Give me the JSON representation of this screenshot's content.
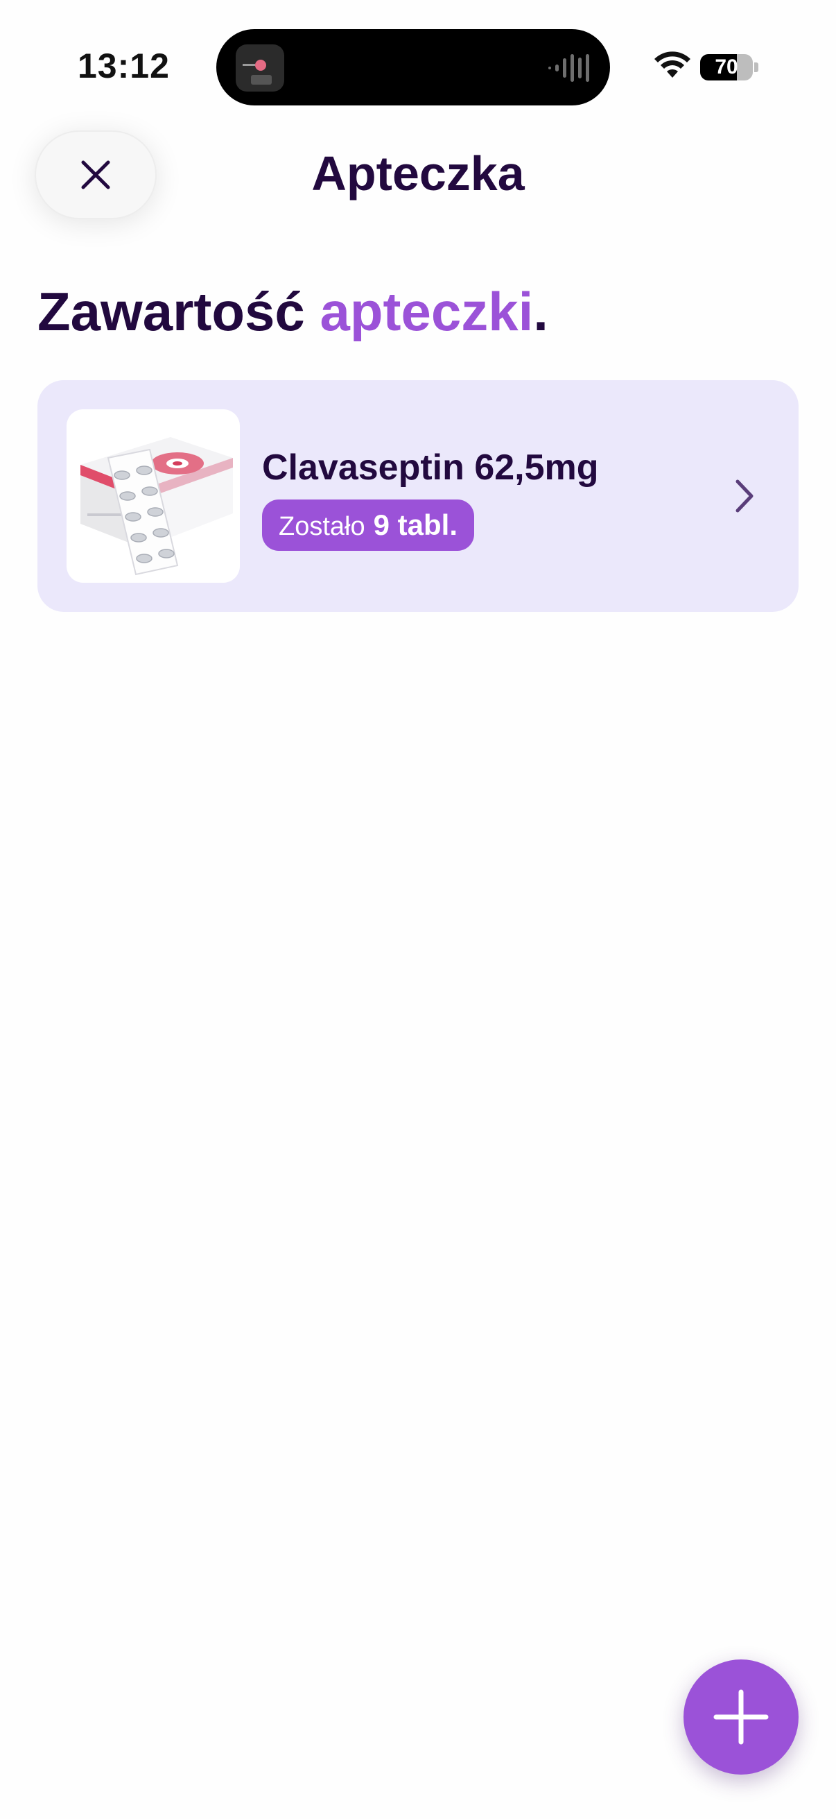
{
  "status_bar": {
    "time": "13:12",
    "battery_level": "70",
    "battery_fraction": 0.7,
    "wifi_icon": "wifi-icon"
  },
  "header": {
    "title": "Apteczka",
    "close_icon": "close-icon"
  },
  "section": {
    "heading_main": "Zawartość",
    "heading_accent": "apteczki",
    "heading_end": "."
  },
  "medicines": [
    {
      "name": "Clavaseptin 62,5mg",
      "remaining_prefix": "Zostało",
      "remaining_count": "9 tabl.",
      "image_icon": "medicine-package-image",
      "chevron_icon": "chevron-right-icon"
    }
  ],
  "fab": {
    "icon": "plus-icon"
  },
  "colors": {
    "primary_text": "#22093f",
    "accent": "#9b52d8",
    "card_background": "#ebe8fb"
  }
}
